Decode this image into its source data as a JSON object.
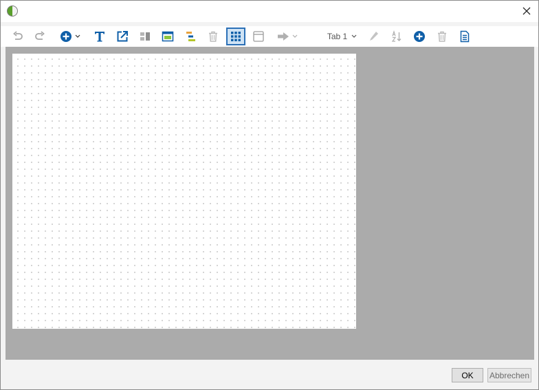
{
  "window": {
    "close_glyph": "✕"
  },
  "toolbar": {
    "tab_select_label": "Tab 1",
    "active_tool": "grid",
    "icons": [
      "undo-icon",
      "redo-icon",
      "add-element-icon",
      "text-icon",
      "link-icon",
      "arrange-icon",
      "frame-icon",
      "align-icon",
      "delete-icon",
      "grid-icon",
      "page-icon",
      "arrow-icon",
      "edit-icon",
      "sort-icon",
      "add-tab-icon",
      "delete-tab-icon",
      "document-icon"
    ]
  },
  "footer": {
    "ok_label": "OK",
    "cancel_label": "Abbrechen"
  },
  "colors": {
    "accent": "#0f5fa8",
    "workspace": "#ababab",
    "active_bg": "#cfe3f5"
  }
}
